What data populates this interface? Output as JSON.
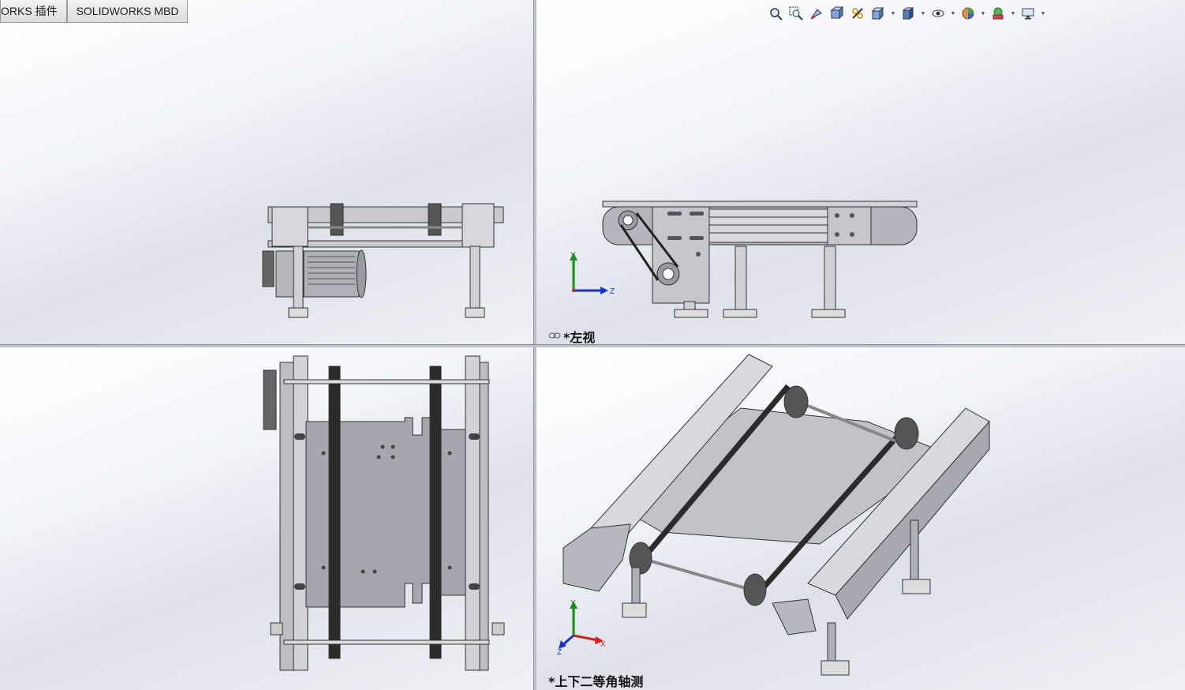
{
  "tabs": [
    {
      "label": "ORKS 插件"
    },
    {
      "label": "SOLIDWORKS MBD"
    }
  ],
  "viewports": {
    "top_left": {
      "label": ""
    },
    "top_right": {
      "label": "*左视"
    },
    "bottom_left": {
      "label": ""
    },
    "bottom_right": {
      "label": "*上下二等角轴测"
    }
  },
  "triad": {
    "x": "X",
    "y": "Y",
    "z": "Z"
  },
  "toolbar": {
    "icons": [
      "zoom-to-fit-icon",
      "zoom-to-area-icon",
      "previous-view-icon",
      "section-view-icon",
      "dynamic-annotation-icon",
      "view-orientation-icon",
      "display-style-icon",
      "hide-show-items-icon",
      "edit-appearance-icon",
      "apply-scene-icon",
      "view-settings-icon"
    ]
  },
  "colors": {
    "triad_x": "#d62020",
    "triad_y": "#1a8a1a",
    "triad_z": "#1a2fd6",
    "metal": "#c9c9cf",
    "metal_dark": "#8a8a92",
    "belt": "#2b2b2b"
  }
}
